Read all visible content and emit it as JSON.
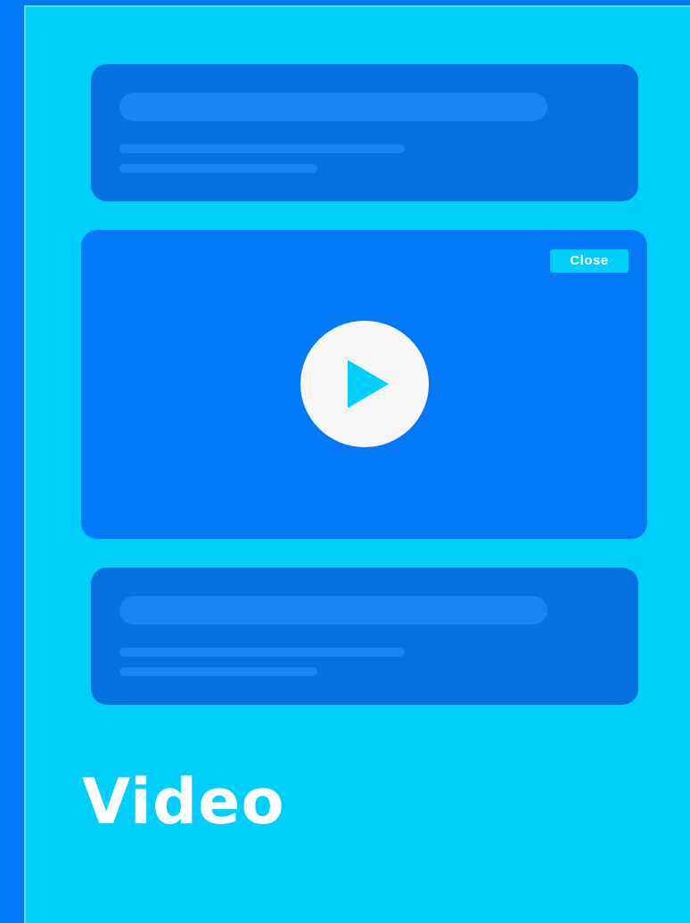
{
  "video_player": {
    "close_label": "Close",
    "play_icon": "play-icon"
  },
  "caption": {
    "title": "Video"
  },
  "colors": {
    "background": "#0379f6",
    "panel": "#00cffc",
    "card": "#0571e3",
    "skeleton": "#1a83f6",
    "play_button": "#f7f7f7",
    "text": "#ffffff"
  }
}
